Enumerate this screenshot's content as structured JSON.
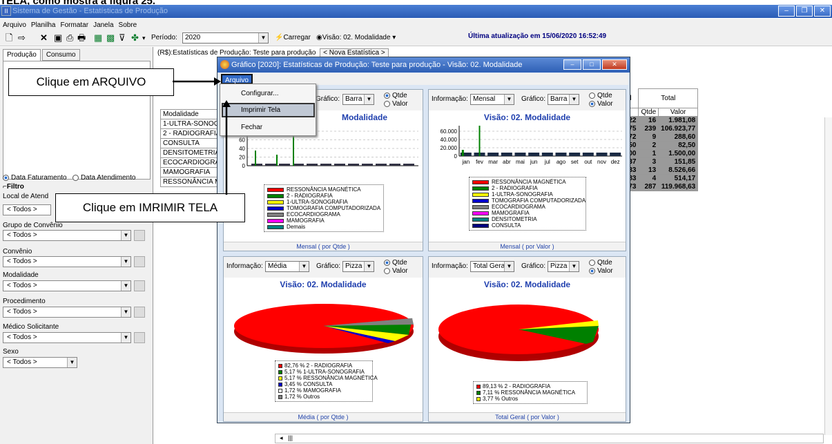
{
  "caption": "TELA, como mostra a figura 25.",
  "window": {
    "title": "Sistema de Gestão - Estatísticas de Produção"
  },
  "menubar": [
    "Arquivo",
    "Planilha",
    "Formatar",
    "Janela",
    "Sobre"
  ],
  "toolbar": {
    "periodo_label": "Período:",
    "periodo_value": "2020",
    "carregar": "Carregar",
    "visao": "Visão: 02. Modalidade",
    "last_update": "Última atualização em 15/06/2020 16:52:49"
  },
  "left": {
    "tabs": [
      "Produção",
      "Consumo"
    ],
    "radio_fat": "Data Faturamento",
    "radio_atend": "Data Atendimento",
    "filtro": "Filtro",
    "local_label": "Local de Atend",
    "local_value": "< Todos >",
    "grupo_label": "Grupo de Convênio",
    "grupo_value": "< Todos >",
    "convenio_label": "Convênio",
    "convenio_value": "< Todos >",
    "modalidade_label": "Modalidade",
    "modalidade_value": "< Todos >",
    "procedimento_label": "Procedimento",
    "procedimento_value": "< Todos >",
    "medico_label": "Médico Solicitante",
    "medico_value": "< Todos >",
    "sexo_label": "Sexo",
    "sexo_value": "< Todos >"
  },
  "main": {
    "tab_label": "(R$):Estatísticas de Produção: Teste para produção",
    "nova": "< Nova Estatística >",
    "grid_rows": [
      "Modalidade",
      "1-ULTRA-SONOGR",
      "2 - RADIOGRAFIA",
      "CONSULTA",
      "DENSITOMETRIA",
      "ECOCARDIOGRAM",
      "MAMOGRAFIA",
      "RESSONÂNCIA M"
    ],
    "right_header": {
      "sal": "sal",
      "total": "Total",
      "r": "r",
      "qtde": "Qtde",
      "valor": "Valor"
    },
    "right_rows": [
      [
        "6,22",
        "16",
        "1.981,08"
      ],
      [
        "4,75",
        "239",
        "106.923,77"
      ],
      [
        "7,72",
        "9",
        "288,60"
      ],
      [
        "6,50",
        "2",
        "82,50"
      ],
      [
        "0,00",
        "1",
        "1.500,00"
      ],
      [
        "0,37",
        "3",
        "151,85"
      ],
      [
        "5,33",
        "13",
        "8.526,66"
      ],
      [
        "2,83",
        "4",
        "514,17"
      ],
      [
        "3,73",
        "287",
        "119.968,63"
      ]
    ],
    "scroll_label": "|||"
  },
  "dialog": {
    "title": "Gráfico [2020]: Estatísticas de Produção: Teste para produção - Visão: 02. Modalidade",
    "menu": "Arquivo",
    "dropdown": [
      "Configurar...",
      "Imprimir Tela",
      "Fechar"
    ],
    "grafico_label": "Gráfico:",
    "info_label": "Informação:",
    "qtde": "Qtde",
    "valor": "Valor",
    "barra": "Barra",
    "pizza": "Pizza",
    "p1": {
      "title": "Modalidade",
      "y_ticks": [
        "80",
        "60",
        "40",
        "20",
        "0"
      ],
      "legend": [
        "RESSONÂNCIA MAGNÉTICA",
        "2 - RADIOGRAFIA",
        "1-ULTRA-SONOGRAFIA",
        "TOMOGRAFIA COMPUTADORIZADA",
        "ECOCARDIOGRAMA",
        "MAMOGRAFIA",
        "Demais"
      ],
      "legend_colors": [
        "#ff0000",
        "#008000",
        "#ffff00",
        "#0000cc",
        "#808080",
        "#ff00ff",
        "#008080"
      ],
      "footer": "Mensal ( por Qtde )"
    },
    "p2": {
      "info": "Mensal",
      "title": "Visão: 02. Modalidade",
      "y_ticks": [
        "60.000",
        "40.000",
        "20.000",
        "0"
      ],
      "months": [
        "jan",
        "fev",
        "mar",
        "abr",
        "mai",
        "jun",
        "jul",
        "ago",
        "set",
        "out",
        "nov",
        "dez"
      ],
      "legend": [
        "RESSONÂNCIA MAGNÉTICA",
        "2 - RADIOGRAFIA",
        "1-ULTRA-SONOGRAFIA",
        "TOMOGRAFIA COMPUTADORIZADA",
        "ECOCARDIOGRAMA",
        "MAMOGRAFIA",
        "DENSITOMETRIA",
        "CONSULTA"
      ],
      "legend_colors": [
        "#ff0000",
        "#008000",
        "#ffff00",
        "#0000cc",
        "#808080",
        "#ff00ff",
        "#008080",
        "#000080"
      ],
      "footer": "Mensal ( por Valor )"
    },
    "p3": {
      "info": "Média",
      "title": "Visão: 02. Modalidade",
      "legend": [
        "82,76 % 2 - RADIOGRAFIA",
        "5,17 % 1-ULTRA-SONOGRAFIA",
        "5,17 % RESSONÂNCIA MAGNÉTICA",
        "3,45 % CONSULTA",
        "1,72 % MAMOGRAFIA",
        "1,72 % Outros"
      ],
      "legend_colors": [
        "#ff0000",
        "#008000",
        "#ffff00",
        "#0000cc",
        "#ffffff",
        "#808080"
      ],
      "footer": "Média ( por Qtde )"
    },
    "p4": {
      "info": "Total Geral",
      "title": "Visão: 02. Modalidade",
      "legend": [
        "89,13 % 2 - RADIOGRAFIA",
        "7,11 % RESSONÂNCIA MAGNÉTICA",
        "3,77 % Outros"
      ],
      "legend_colors": [
        "#ff0000",
        "#008000",
        "#ffff00"
      ],
      "footer": "Total Geral ( por Valor )"
    }
  },
  "callouts": {
    "arquivo": "Clique em ARQUIVO",
    "imprimir": "Clique em IMRIMIR TELA"
  }
}
